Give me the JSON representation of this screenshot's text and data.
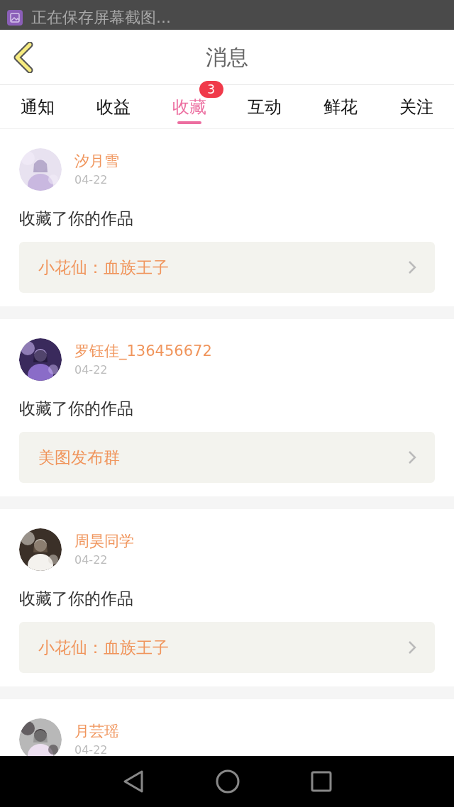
{
  "notification": {
    "text": "正在保存屏幕截图..."
  },
  "header": {
    "title": "消息"
  },
  "tabs": [
    {
      "label": "通知",
      "selected": false
    },
    {
      "label": "收益",
      "selected": false
    },
    {
      "label": "收藏",
      "selected": true,
      "badge": "3"
    },
    {
      "label": "互动",
      "selected": false
    },
    {
      "label": "鲜花",
      "selected": false
    },
    {
      "label": "关注",
      "selected": false
    }
  ],
  "messages": [
    {
      "name": "汐月雪",
      "date": "04-22",
      "text": "收藏了你的作品",
      "link": "小花仙：血族王子"
    },
    {
      "name": "罗钰佳_136456672",
      "date": "04-22",
      "text": "收藏了你的作品",
      "link": "美图发布群"
    },
    {
      "name": "周昊同学",
      "date": "04-22",
      "text": "收藏了你的作品",
      "link": "小花仙：血族王子"
    },
    {
      "name": "月芸瑶",
      "date": "04-22"
    }
  ]
}
